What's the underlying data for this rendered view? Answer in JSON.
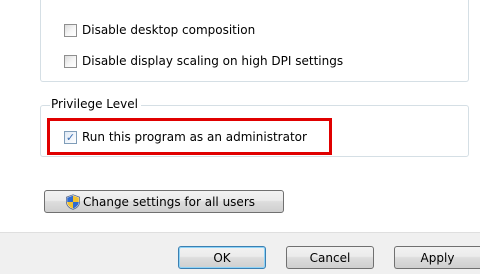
{
  "compatibility": {
    "options": [
      {
        "label": "Disable desktop composition",
        "checked": false
      },
      {
        "label": "Disable display scaling on high DPI settings",
        "checked": false
      }
    ]
  },
  "privilege_level": {
    "legend": "Privilege Level",
    "run_as_admin": {
      "label": "Run this program as an administrator",
      "checked": true
    }
  },
  "change_settings_button": {
    "label": "Change settings for all users",
    "icon": "uac-shield-icon"
  },
  "dialog_buttons": {
    "ok": "OK",
    "cancel": "Cancel",
    "apply": "Apply"
  },
  "colors": {
    "highlight": "#e00000",
    "window_background": "#f0f0f0",
    "panel_background": "#ffffff"
  }
}
